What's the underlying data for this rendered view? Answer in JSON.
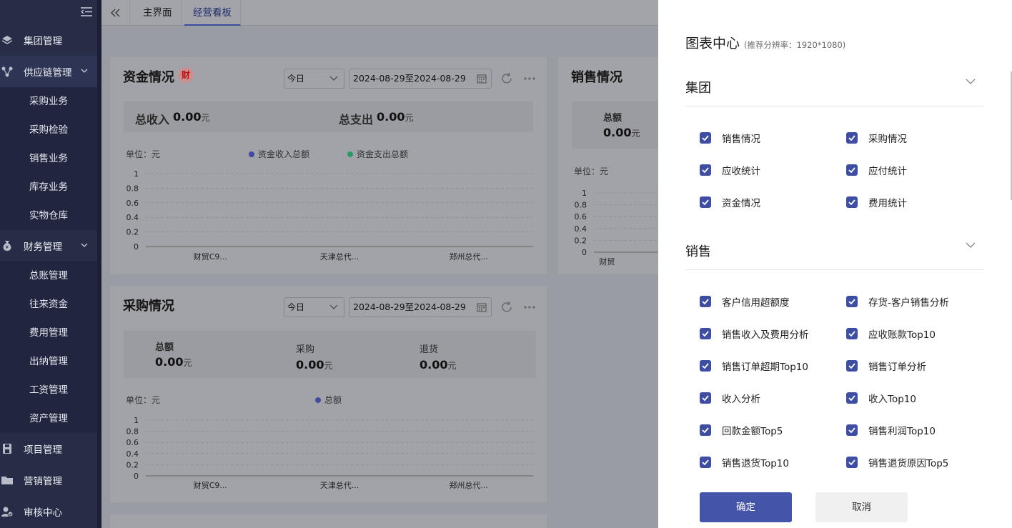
{
  "sidebar": {
    "items": [
      {
        "label": "集团管理",
        "icon": "layers-icon"
      },
      {
        "label": "供应链管理",
        "icon": "network-icon",
        "children": [
          "采购业务",
          "采购检验",
          "销售业务",
          "库存业务",
          "实物仓库"
        ]
      },
      {
        "label": "财务管理",
        "icon": "money-bag-icon",
        "children": [
          "总账管理",
          "往来资金",
          "费用管理",
          "出纳管理",
          "工资管理",
          "资产管理"
        ]
      },
      {
        "label": "项目管理",
        "icon": "floppy-icon"
      },
      {
        "label": "营销管理",
        "icon": "folder-icon"
      },
      {
        "label": "审核中心",
        "icon": "audit-icon"
      }
    ]
  },
  "tabs": [
    {
      "label": "主界面",
      "active": false
    },
    {
      "label": "经营看板",
      "active": true
    }
  ],
  "funds": {
    "title": "资金情况",
    "badge": "财",
    "period": "今日",
    "date_range": "2024-08-29至2024-08-29",
    "income_label": "总收入",
    "income_value": "0.00",
    "expense_label": "总支出",
    "expense_value": "0.00",
    "currency": "元",
    "unit_label": "单位：元",
    "legend": [
      {
        "label": "资金收入总额",
        "color": "#3f4da0"
      },
      {
        "label": "资金支出总额",
        "color": "#2c9a67"
      }
    ]
  },
  "purchase": {
    "title": "采购情况",
    "period": "今日",
    "date_range": "2024-08-29至2024-08-29",
    "total_label": "总额",
    "total_value": "0.00",
    "buy_label": "采购",
    "buy_value": "0.00",
    "return_label": "退货",
    "return_value": "0.00",
    "currency": "元",
    "unit_label": "单位：元",
    "legend": [
      {
        "label": "总额",
        "color": "#3f4da0"
      }
    ]
  },
  "sales": {
    "title": "销售情况",
    "total_label": "总额",
    "total_value": "0.00",
    "currency": "元",
    "unit_label": "单位：元",
    "partial_category": "财贸"
  },
  "chart_data": [
    {
      "type": "bar",
      "categories": [
        "财贸C9...",
        "天津总代...",
        "郑州总代..."
      ],
      "series": [
        {
          "name": "资金收入总额",
          "values": [
            0,
            0,
            0
          ]
        },
        {
          "name": "资金支出总额",
          "values": [
            0,
            0,
            0
          ]
        }
      ],
      "ylim": [
        0,
        1
      ],
      "yticks": [
        "0",
        "0.2",
        "0.4",
        "0.6",
        "0.8",
        "1"
      ],
      "ylabel": "单位：元",
      "grid": true,
      "legend_position": "top"
    },
    {
      "type": "bar",
      "categories": [
        "财贸C9...",
        "天津总代...",
        "郑州总代..."
      ],
      "series": [
        {
          "name": "总额",
          "values": [
            0,
            0,
            0
          ]
        }
      ],
      "ylim": [
        0,
        1
      ],
      "yticks": [
        "0",
        "0.2",
        "0.4",
        "0.6",
        "0.8",
        "1"
      ],
      "ylabel": "单位：元",
      "grid": true,
      "legend_position": "top"
    },
    {
      "type": "bar",
      "categories": [
        "财贸"
      ],
      "ylim": [
        0,
        1
      ],
      "yticks": [
        "0",
        "0.2",
        "0.4",
        "0.6",
        "0.8",
        "1"
      ],
      "ylabel": "单位：元",
      "grid": true
    }
  ],
  "panel": {
    "title": "图表中心",
    "subtitle": "(推荐分辨率：1920*1080)",
    "sections": [
      {
        "title": "集团",
        "items": [
          "销售情况",
          "采购情况",
          "应收统计",
          "应付统计",
          "资金情况",
          "费用统计"
        ]
      },
      {
        "title": "销售",
        "items": [
          "客户信用超额度",
          "存货-客户销售分析",
          "销售收入及费用分析",
          "应收账款Top10",
          "销售订单超期Top10",
          "销售订单分析",
          "收入分析",
          "收入Top10",
          "回款金额Top5",
          "销售利润Top10",
          "销售退货Top10",
          "销售退货原因Top5"
        ]
      }
    ],
    "ok_label": "确定",
    "cancel_label": "取消"
  }
}
